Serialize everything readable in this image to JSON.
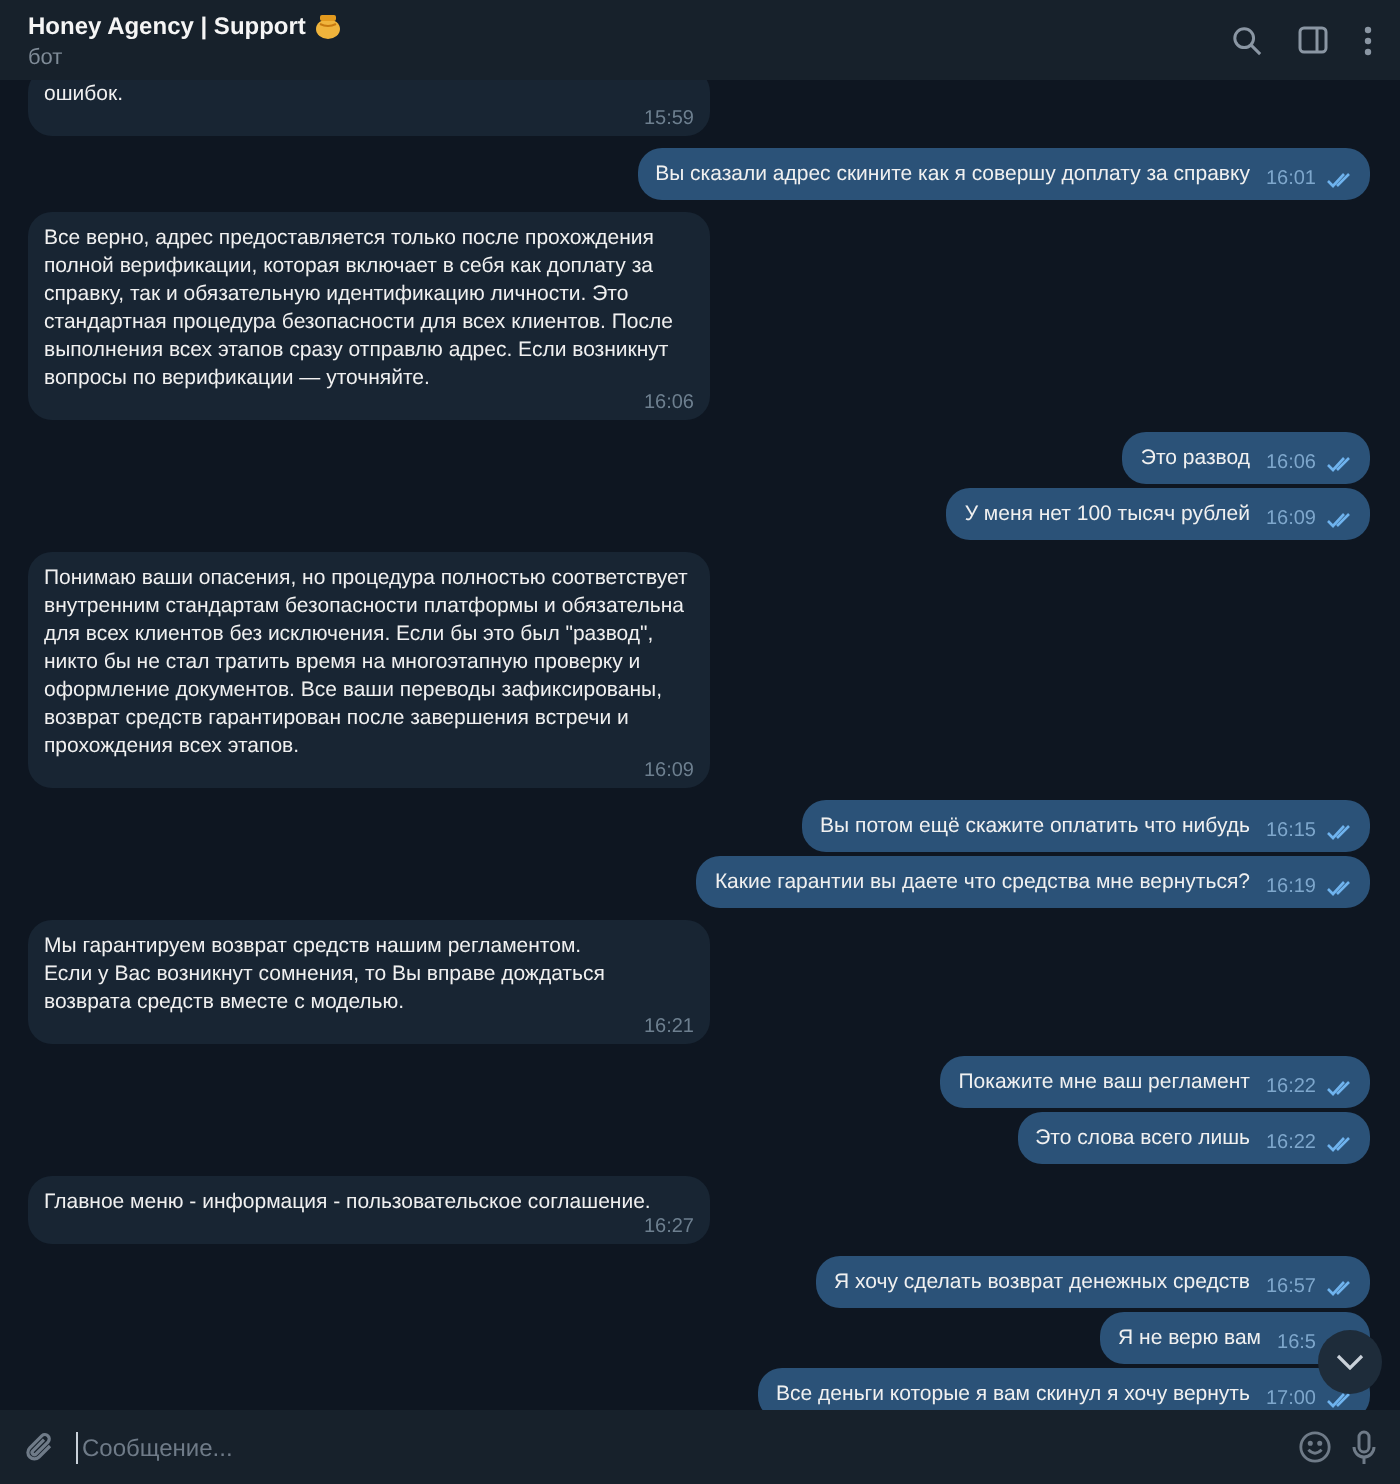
{
  "header": {
    "title": "Honey Agency | Support",
    "subtitle": "бот"
  },
  "messages": [
    {
      "kind": "incoming",
      "text": "ошибок.",
      "time": "15:59"
    },
    {
      "kind": "outgoing",
      "text": "Вы сказали адрес скините как я совершу доплату за справку",
      "time": "16:01",
      "read": true
    },
    {
      "kind": "incoming",
      "text": "Все верно, адрес предоставляется только после прохождения полной верификации, которая включает в себя как доплату за справку, так и обязательную идентификацию личности. Это стандартная процедура безопасности для всех клиентов. После выполнения всех этапов сразу отправлю адрес. Если возникнут вопросы по верификации — уточняйте.",
      "time": "16:06"
    },
    {
      "kind": "outgoing",
      "text": "Это развод",
      "time": "16:06",
      "read": true
    },
    {
      "kind": "outgoing",
      "text": "У меня нет 100 тысяч рублей",
      "time": "16:09",
      "read": true
    },
    {
      "kind": "incoming",
      "text": "Понимаю ваши опасения, но процедура полностью соответствует внутренним стандартам безопасности платформы и обязательна для всех клиентов без исключения. Если бы это был \"развод\", никто бы не стал тратить время на многоэтапную проверку и оформление документов. Все ваши переводы зафиксированы, возврат средств гарантирован после завершения встречи и прохождения всех этапов.",
      "time": "16:09"
    },
    {
      "kind": "outgoing",
      "text": "Вы потом ещё скажите оплатить что нибудь",
      "time": "16:15",
      "read": true
    },
    {
      "kind": "outgoing",
      "text": "Какие гарантии вы даете что средства мне вернуться?",
      "time": "16:19",
      "read": true
    },
    {
      "kind": "incoming",
      "text": "Мы гарантируем возврат средств нашим регламентом.\nЕсли у Вас возникнут сомнения, то Вы вправе дождаться возврата средств вместе с моделью.",
      "time": "16:21"
    },
    {
      "kind": "outgoing",
      "text": "Покажите мне ваш регламент",
      "time": "16:22",
      "read": true
    },
    {
      "kind": "outgoing",
      "text": "Это слова всего лишь",
      "time": "16:22",
      "read": true
    },
    {
      "kind": "incoming",
      "text": "Главное меню - информация - пользовательское соглашение.",
      "time": "16:27"
    },
    {
      "kind": "outgoing",
      "text": "Я хочу сделать возврат денежных средств",
      "time": "16:57",
      "read": true
    },
    {
      "kind": "outgoing",
      "text": "Я не верю вам",
      "time": "16:5"
    },
    {
      "kind": "outgoing",
      "text": "Все деньги которые я вам скинул я хочу вернуть",
      "time": "17:00",
      "read": true
    }
  ],
  "composer": {
    "placeholder": "Сообщение..."
  }
}
